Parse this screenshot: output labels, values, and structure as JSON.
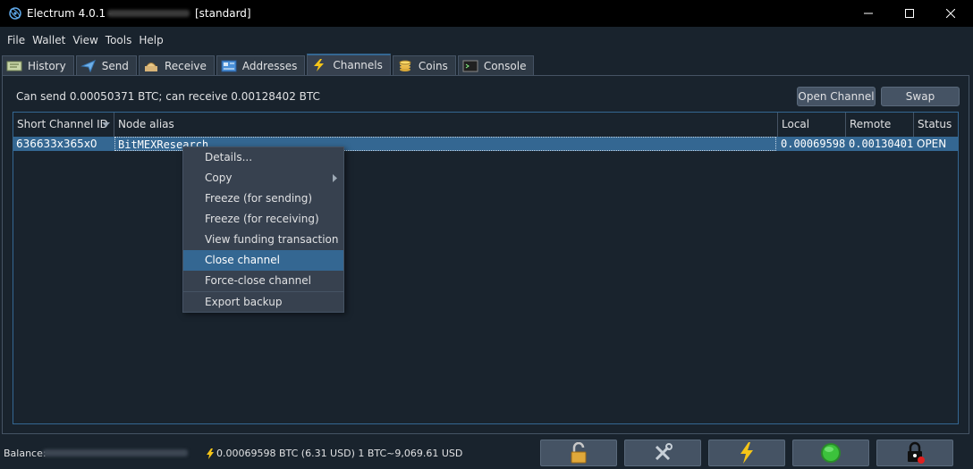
{
  "window": {
    "title": "Electrum 4.0.1  -",
    "wallet_type": "[standard]",
    "controls": [
      "minimize",
      "maximize",
      "close"
    ]
  },
  "menu": [
    "File",
    "Wallet",
    "View",
    "Tools",
    "Help"
  ],
  "tabs": [
    {
      "label": "History",
      "icon": "history-icon"
    },
    {
      "label": "Send",
      "icon": "send-icon"
    },
    {
      "label": "Receive",
      "icon": "receive-icon"
    },
    {
      "label": "Addresses",
      "icon": "addresses-icon"
    },
    {
      "label": "Channels",
      "icon": "lightning-icon",
      "active": true
    },
    {
      "label": "Coins",
      "icon": "coins-icon"
    },
    {
      "label": "Console",
      "icon": "console-icon"
    }
  ],
  "channels": {
    "summary": "Can send 0.00050371 BTC; can receive 0.00128402 BTC",
    "open_channel_label": "Open Channel",
    "swap_label": "Swap",
    "columns": [
      "Short Channel ID",
      "Node alias",
      "Local",
      "Remote",
      "Status"
    ],
    "rows": [
      {
        "short_channel_id": "636633x365x0",
        "node_alias": "BitMEXResearch",
        "local": "0.00069598",
        "remote": "0.00130401",
        "status": "OPEN"
      }
    ]
  },
  "context_menu": {
    "items": [
      "Details...",
      "Copy",
      "Freeze (for sending)",
      "Freeze (for receiving)",
      "View funding transaction",
      "Close channel",
      "Force-close channel",
      "Export backup"
    ],
    "highlighted": "Close channel"
  },
  "statusbar": {
    "balance_label": "Balance:",
    "lightning_text": "0.00069598 BTC (6.31 USD) 1 BTC~9,069.61 USD",
    "buttons": [
      "lock-icon",
      "tools-icon",
      "lightning-icon",
      "network-status-icon",
      "seed-icon"
    ]
  },
  "colors": {
    "background": "#19232d",
    "selection": "#346792",
    "button": "#455364",
    "lightning": "#f5c518",
    "status_ok": "#3cc23c"
  }
}
